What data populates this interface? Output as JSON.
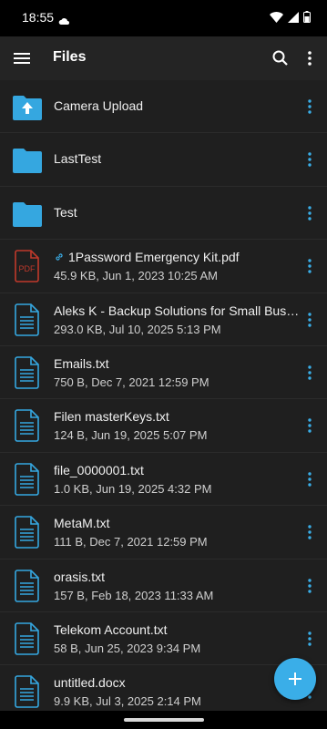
{
  "status_bar": {
    "time": "18:55"
  },
  "app_bar": {
    "title": "Files"
  },
  "items": [
    {
      "kind": "folder",
      "icon": "folder-upload-icon",
      "name": "Camera Upload"
    },
    {
      "kind": "folder",
      "icon": "folder-icon",
      "name": "LastTest"
    },
    {
      "kind": "folder",
      "icon": "folder-icon",
      "name": "Test"
    },
    {
      "kind": "file",
      "icon": "pdf-file-icon",
      "linked": true,
      "name": "1Password Emergency Kit.pdf",
      "meta": "45.9 KB, Jun 1, 2023 10:25 AM"
    },
    {
      "kind": "file",
      "icon": "document-icon",
      "name": "Aleks K - Backup Solutions for Small Businesses",
      "meta": "293.0 KB, Jul 10, 2025 5:13 PM"
    },
    {
      "kind": "file",
      "icon": "document-icon",
      "name": "Emails.txt",
      "meta": "750 B, Dec 7, 2021 12:59 PM"
    },
    {
      "kind": "file",
      "icon": "document-icon",
      "name": "Filen masterKeys.txt",
      "meta": "124 B, Jun 19, 2025 5:07 PM"
    },
    {
      "kind": "file",
      "icon": "document-icon",
      "name": "file_0000001.txt",
      "meta": "1.0 KB, Jun 19, 2025 4:32 PM"
    },
    {
      "kind": "file",
      "icon": "document-icon",
      "name": "MetaM.txt",
      "meta": "111 B, Dec 7, 2021 12:59 PM"
    },
    {
      "kind": "file",
      "icon": "document-icon",
      "name": "orasis.txt",
      "meta": "157 B, Feb 18, 2023 11:33 AM"
    },
    {
      "kind": "file",
      "icon": "document-icon",
      "name": "Telekom Account.txt",
      "meta": "58 B, Jun 25, 2023 9:34 PM"
    },
    {
      "kind": "file",
      "icon": "document-icon",
      "name": "untitled.docx",
      "meta": "9.9 KB, Jul 3, 2025 2:14 PM"
    }
  ],
  "colors": {
    "accent": "#3aaee8",
    "folder": "#35a7e0",
    "pdf": "#c0392b",
    "appbar": "#242424",
    "list_bg": "#1f1f1f"
  },
  "fab": {
    "icon": "plus-icon"
  }
}
